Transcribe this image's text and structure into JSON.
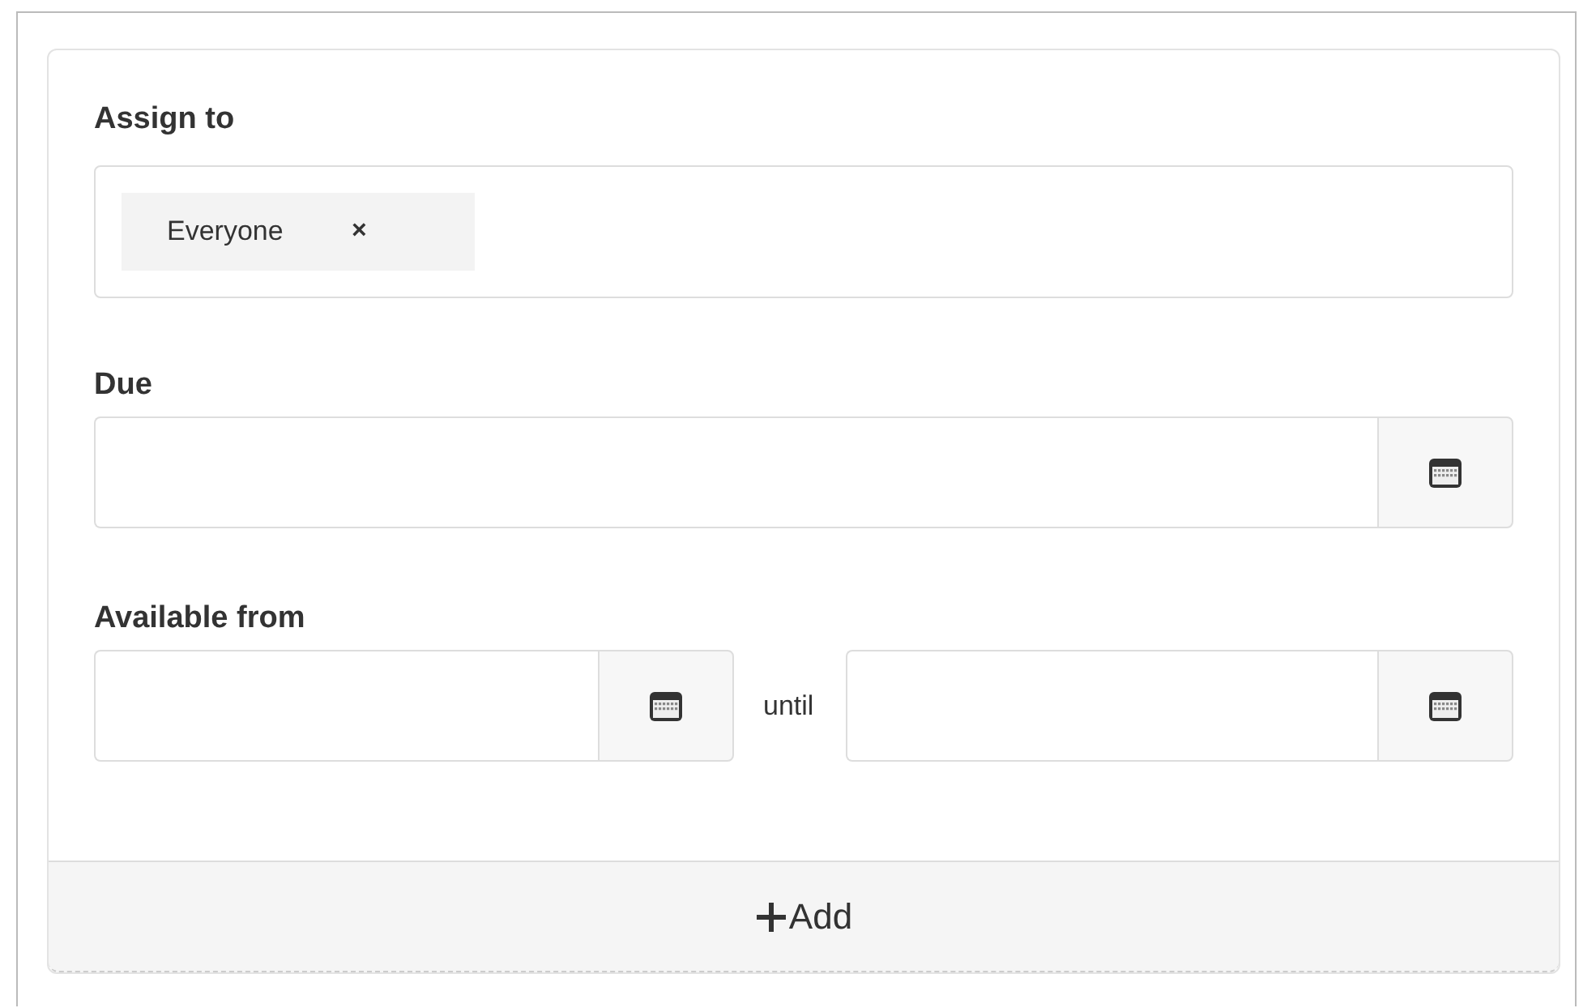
{
  "assign": {
    "label": "Assign to",
    "tokens": [
      {
        "text": "Everyone",
        "remove": "×"
      }
    ]
  },
  "due": {
    "label": "Due"
  },
  "available": {
    "label": "Available from",
    "separator": "until"
  },
  "add_button": {
    "label": "Add"
  }
}
